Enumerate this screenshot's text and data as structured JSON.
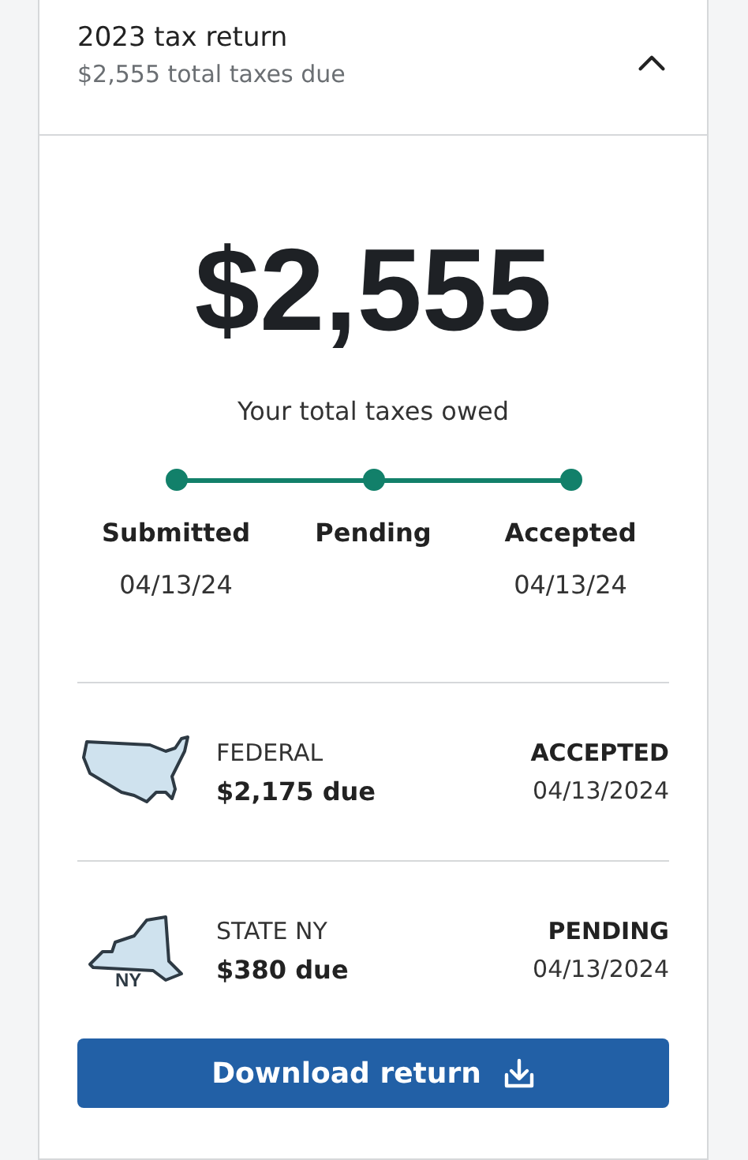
{
  "header": {
    "title": "2023 tax return",
    "subtitle": "$2,555 total taxes due",
    "expanded": true
  },
  "summary": {
    "amount": "$2,555",
    "caption": "Your total taxes owed"
  },
  "steps": [
    {
      "label": "Submitted",
      "date": "04/13/24",
      "done": true
    },
    {
      "label": "Pending",
      "done": true
    },
    {
      "label": "Accepted",
      "date": "04/13/24",
      "done": true
    }
  ],
  "returns": [
    {
      "kind": "federal",
      "name": "FEDERAL",
      "due": "$2,175 due",
      "status": "ACCEPTED",
      "date": "04/13/2024"
    },
    {
      "kind": "state",
      "badge": "NY",
      "name": "STATE NY",
      "due": "$380 due",
      "status": "PENDING",
      "date": "04/13/2024"
    }
  ],
  "button": {
    "label": "Download return"
  }
}
